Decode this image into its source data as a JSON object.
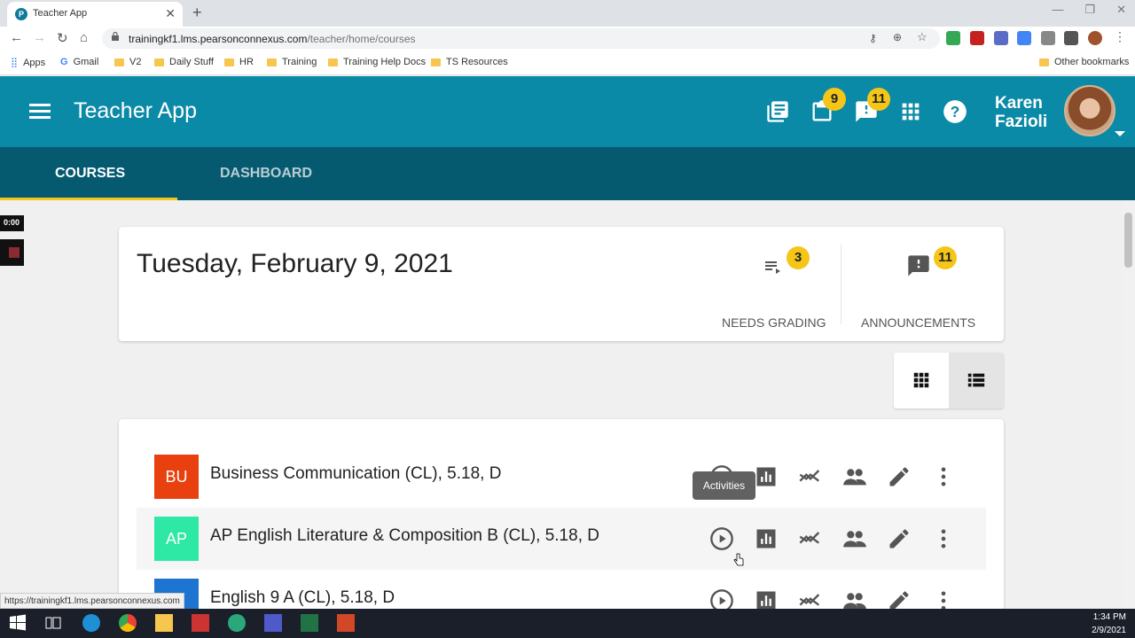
{
  "browser": {
    "tab_title": "Teacher App",
    "url_host": "trainingkf1.lms.pearsonconnexus.com",
    "url_path": "/teacher/home/courses",
    "bookmarks": [
      "Apps",
      "Gmail",
      "V2",
      "Daily Stuff",
      "HR",
      "Training",
      "Training Help Docs",
      "TS Resources"
    ],
    "other_bookmarks": "Other bookmarks",
    "status_url": "https://trainingkf1.lms.pearsonconnexus.com"
  },
  "recording": {
    "timer": "0:00"
  },
  "app": {
    "title": "Teacher App",
    "assignments_badge": "9",
    "alerts_badge": "11",
    "user_first": "Karen",
    "user_last": "Fazioli",
    "accent": "#0b8aa7",
    "dark_accent": "#065a70",
    "badge_color": "#f5c518"
  },
  "tabs": {
    "courses": "COURSES",
    "dashboard": "DASHBOARD"
  },
  "summary": {
    "date": "Tuesday, February 9, 2021",
    "needs_grading_count": "3",
    "needs_grading_label": "NEEDS GRADING",
    "announcements_count": "11",
    "announcements_label": "ANNOUNCEMENTS"
  },
  "courses": [
    {
      "abbr": "BU",
      "name": "Business Communication (CL), 5.18, D",
      "color": "#e8400f"
    },
    {
      "abbr": "AP",
      "name": "AP English Literature & Composition B (CL), 5.18, D",
      "color": "#2ee8a5"
    },
    {
      "abbr": "",
      "name": "English 9 A (CL), 5.18, D",
      "color": "#1e74d1"
    }
  ],
  "tooltip": "Activities",
  "taskbar": {
    "time": "1:34 PM",
    "date": "2/9/2021"
  }
}
